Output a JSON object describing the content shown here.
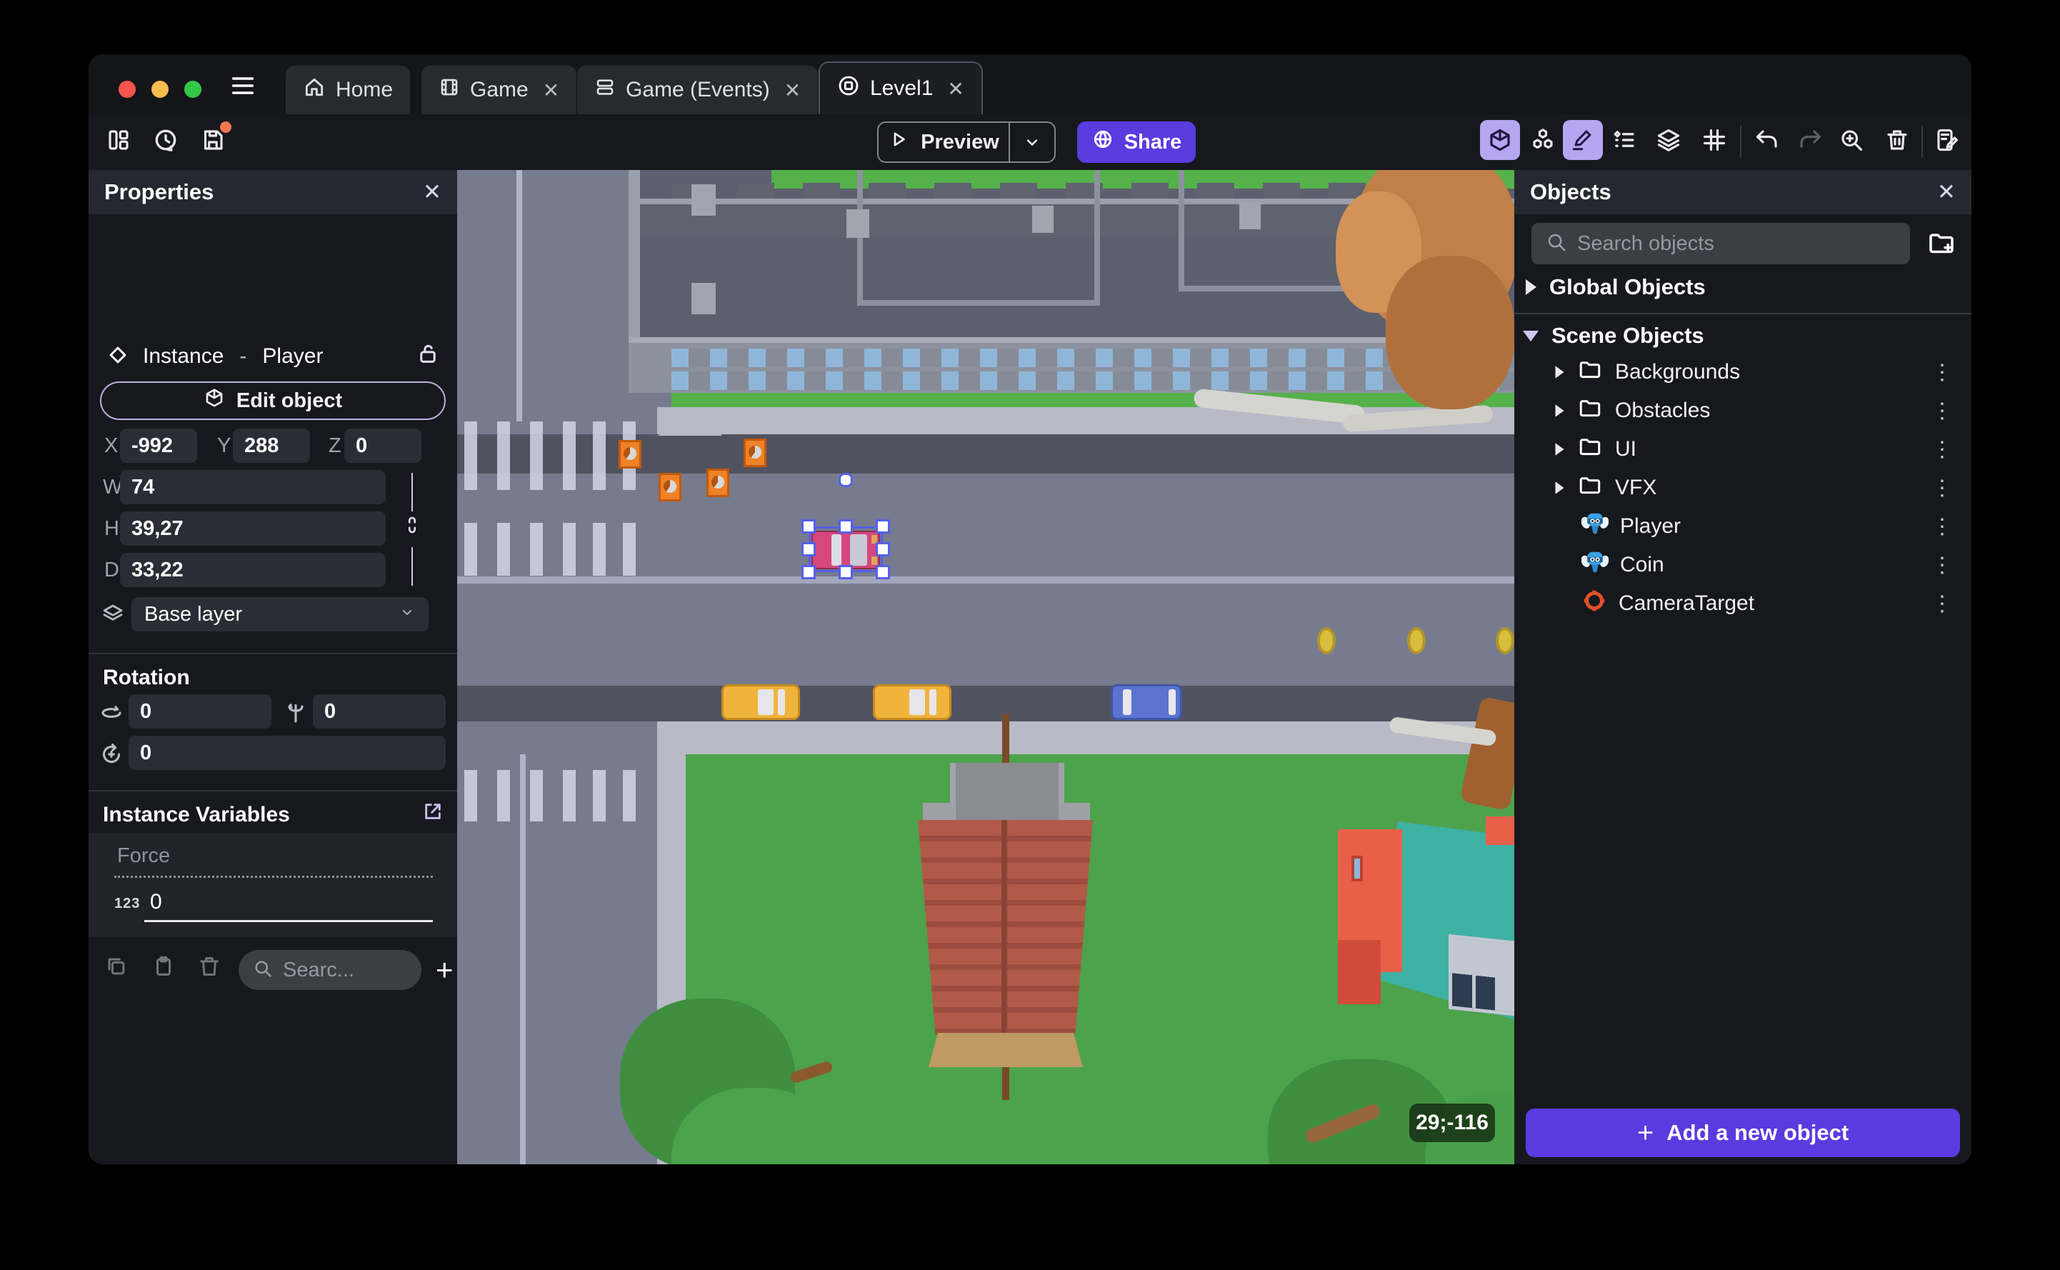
{
  "tabs": {
    "home": "Home",
    "game": "Game",
    "events": "Game (Events)",
    "level": "Level1"
  },
  "toolbar": {
    "preview_label": "Preview",
    "share_label": "Share"
  },
  "properties": {
    "title": "Properties",
    "instance_type": "Instance",
    "dash": "-",
    "object_name": "Player",
    "edit_button": "Edit object",
    "x_label": "X",
    "x_value": "-992",
    "y_label": "Y",
    "y_value": "288",
    "z_label": "Z",
    "z_value": "0",
    "w_label": "W",
    "w_value": "74",
    "h_label": "H",
    "h_value": "39,27",
    "d_label": "D",
    "d_value": "33,22",
    "layer_value": "Base layer",
    "rotation_title": "Rotation",
    "rot_x": "0",
    "rot_y": "0",
    "rot_z": "0",
    "variables_title": "Instance Variables",
    "variable_name": "Force",
    "variable_type_icon": "123",
    "variable_value": "0",
    "search_placeholder": "Searc..."
  },
  "objects": {
    "title": "Objects",
    "search_placeholder": "Search objects",
    "global_group": "Global Objects",
    "scene_group": "Scene Objects",
    "folders": [
      "Backgrounds",
      "Obstacles",
      "UI",
      "VFX"
    ],
    "items": [
      "Player",
      "Coin",
      "CameraTarget"
    ],
    "add_button": "Add a new object"
  },
  "canvas": {
    "cursor_badge": "29;-116"
  },
  "icons": {
    "close": "✕",
    "kebab": "⋮",
    "plus": "+"
  },
  "colors": {
    "accent_purple": "#5a3be0",
    "active_tool_bg": "#b5a6f2",
    "selection_blue": "#5560e8",
    "save_dot_orange": "#f07850",
    "traffic_red": "#f5554c",
    "traffic_yellow": "#f6bf4e",
    "traffic_green": "#33c748",
    "grass_green": "#4da24c",
    "road_gray": "#767b8e",
    "player_car_pink": "#d6477e"
  }
}
